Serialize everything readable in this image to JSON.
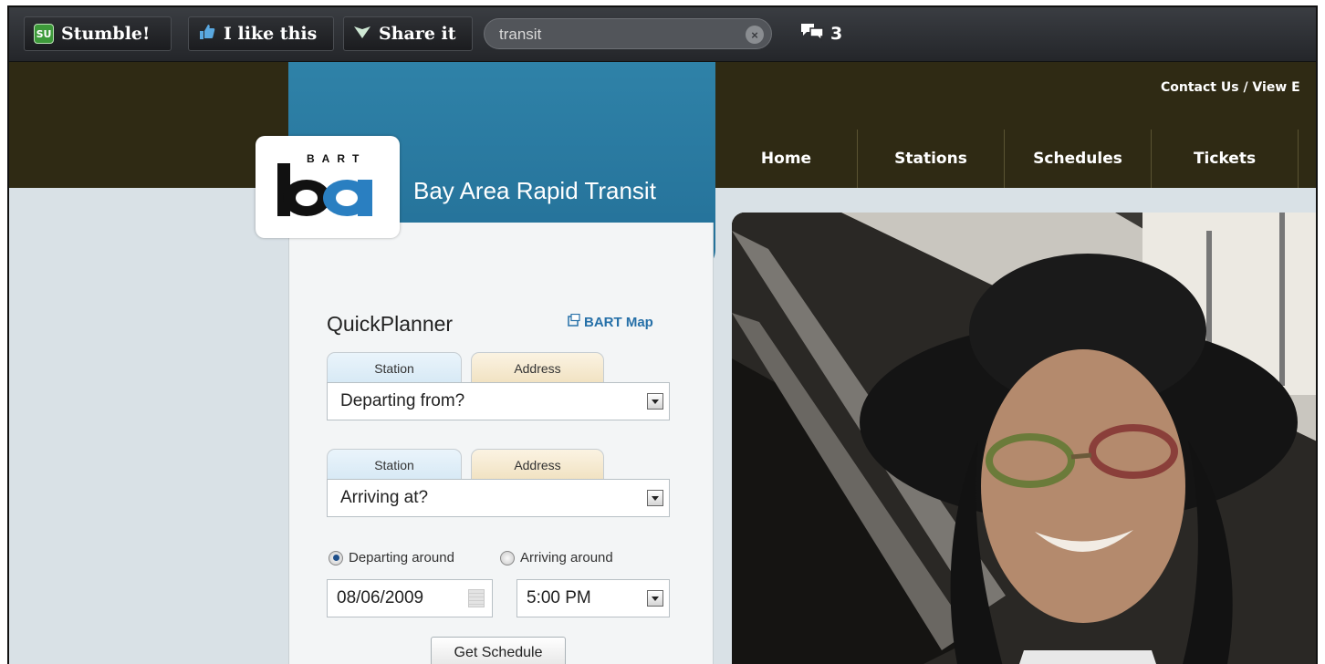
{
  "toolbar": {
    "stumble_label": "Stumble!",
    "stumble_icon": "SU",
    "like_label": "I like this",
    "share_label": "Share it",
    "search_value": "transit",
    "comments_count": "3"
  },
  "header": {
    "top_links": "Contact Us / View E",
    "nav": [
      "Home",
      "Stations",
      "Schedules",
      "Tickets"
    ],
    "logo_letters": "BART",
    "site_title": "Bay Area Rapid Transit"
  },
  "planner": {
    "title": "QuickPlanner",
    "map_link": "BART Map",
    "from": {
      "tab_station": "Station",
      "tab_address": "Address",
      "value": "Departing from?"
    },
    "to": {
      "tab_station": "Station",
      "tab_address": "Address",
      "value": "Arriving at?"
    },
    "radio_departing": "Departing around",
    "radio_arriving": "Arriving around",
    "date": "08/06/2009",
    "time": "5:00 PM",
    "submit": "Get Schedule"
  },
  "colors": {
    "toolbar_bg": "#2b2d31",
    "header_bg": "#2f2a14",
    "bart_blue": "#2a7aa3",
    "page_bg": "#d9e1e6"
  }
}
